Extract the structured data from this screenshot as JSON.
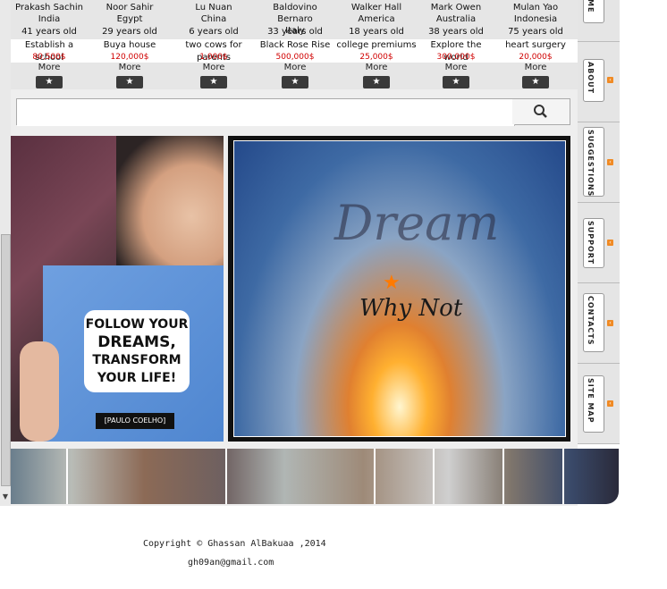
{
  "dreamers": [
    {
      "name": "Prakash Sachin\nIndia",
      "age": "41 years old",
      "dream": "Establish a school",
      "price": "80,500$",
      "more": "More",
      "star": "★"
    },
    {
      "name": "Noor  Sahir\nEgypt",
      "age": "29 years old",
      "dream": "Buya house",
      "price": "120,000$",
      "more": "More",
      "star": "★"
    },
    {
      "name": "Lu  Nuan\nChina",
      "age": "6 years old",
      "dream": "two cows for parents",
      "price": "1,000$",
      "more": "More",
      "star": "★"
    },
    {
      "name": "Baldovino  Bernaro\nItaly",
      "age": "33 years old",
      "dream": "Black Rose Rise",
      "price": "500,000$",
      "more": "More",
      "star": "★"
    },
    {
      "name": "Walker  Hall\nAmerica",
      "age": "18 years old",
      "dream": "college premiums",
      "price": "25,000$",
      "more": "More",
      "star": "★"
    },
    {
      "name": "Mark Owen\nAustralia",
      "age": "38 years old",
      "dream": "Explore the world",
      "price": "300,000$",
      "more": "More",
      "star": "★"
    },
    {
      "name": "Mulan Yao\nIndonesia",
      "age": "75 years old",
      "dream": "heart surgery",
      "price": "20,000$",
      "more": "More",
      "star": "★"
    }
  ],
  "search": {
    "placeholder": "",
    "button_icon": "search-icon"
  },
  "left_image": {
    "quote_lines": [
      "FOLLOW YOUR",
      "DREAMS,",
      "TRANSFORM",
      "YOUR LIFE!"
    ],
    "author": "[PAULO COELHO]"
  },
  "right_image": {
    "title": "Dream",
    "subtitle": "Why Not"
  },
  "nav": {
    "items": [
      {
        "label": "ME"
      },
      {
        "label": "ABOUT"
      },
      {
        "label": "SUGGESTIONS"
      },
      {
        "label": "SUPPORT"
      },
      {
        "label": "CONTACTS"
      },
      {
        "label": "SITE MAP"
      }
    ]
  },
  "footer": {
    "copyright": "Copyright © Ghassan AlBakuaa ,2014",
    "email": "gh09an@gmail.com"
  },
  "colors": {
    "price": "#d00000",
    "nav_arrow": "#f08a24",
    "star_button": "#3a3a3a"
  }
}
